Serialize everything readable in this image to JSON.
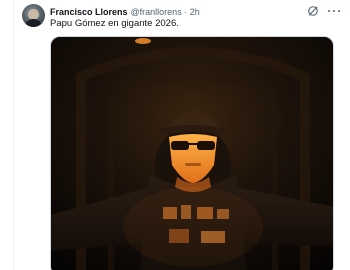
{
  "tweet": {
    "author_name": "Francisco Llorens",
    "author_handle": "@franllorens",
    "separator": "·",
    "time": "2h",
    "text": "Papu Gómez en gigante 2026."
  },
  "icons": {
    "grok": "grok-icon",
    "more": "more-icon"
  },
  "colors": {
    "secondary_text": "#536471",
    "primary_text": "#0f1419",
    "media_glow": "#ff8a1a"
  }
}
